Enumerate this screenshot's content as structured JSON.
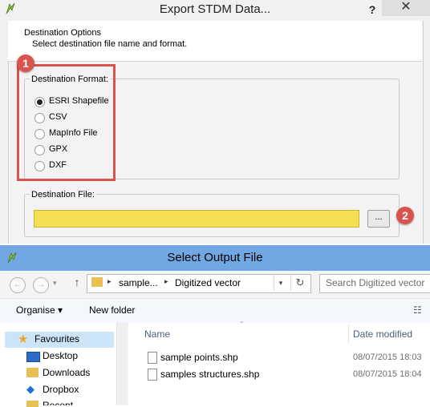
{
  "export_dialog": {
    "title": "Export STDM Data...",
    "help_button": "?",
    "close_button": "✕",
    "header_title": "Destination Options",
    "header_subtitle": "Select destination file name and format.",
    "format_group_title": "Destination Format:",
    "formats": [
      {
        "label": "ESRI Shapefile",
        "selected": true
      },
      {
        "label": "CSV",
        "selected": false
      },
      {
        "label": "MapInfo File",
        "selected": false
      },
      {
        "label": "GPX",
        "selected": false
      },
      {
        "label": "DXF",
        "selected": false
      }
    ],
    "file_group_title": "Destination File:",
    "file_path_value": "",
    "browse_label": "...",
    "badge_1": "1",
    "badge_2": "2",
    "highlight_color": "#d9534f",
    "file_field_color": "#f7df51"
  },
  "save_dialog": {
    "title": "Select Output File",
    "address": {
      "crumbs": [
        "sample...",
        "Digitized vector"
      ]
    },
    "search_placeholder": "Search Digitized vector",
    "toolbar": {
      "organise_label": "Organise ▾",
      "new_folder_label": "New folder"
    },
    "nav_pane": {
      "items": [
        "Favourites",
        "Desktop",
        "Downloads",
        "Dropbox",
        "Recent..."
      ]
    },
    "columns": {
      "name": "Name",
      "date_modified": "Date modified"
    },
    "files": [
      {
        "name": "sample points.shp",
        "date": "08/07/2015 18:03"
      },
      {
        "name": "samples structures.shp",
        "date": "08/07/2015 18:04"
      }
    ],
    "titlebar_color": "#71a7e2"
  }
}
